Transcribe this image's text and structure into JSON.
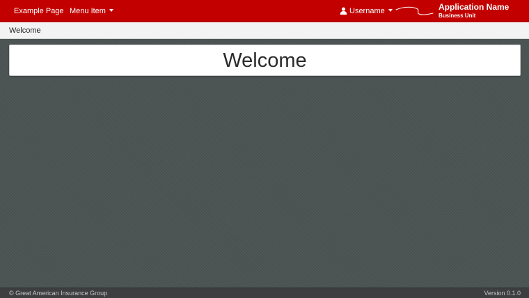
{
  "navbar": {
    "left_items": [
      {
        "label": "Example Page",
        "has_dropdown": false
      },
      {
        "label": "Menu Item",
        "has_dropdown": true
      }
    ],
    "user": {
      "label": "Username",
      "icon": "user-icon",
      "has_dropdown": true
    },
    "brand": {
      "app_name": "Application Name",
      "business_unit": "Business Unit"
    }
  },
  "subheader": {
    "title": "Welcome"
  },
  "main": {
    "heading": "Welcome"
  },
  "footer": {
    "copyright": "© Great American Insurance Group",
    "version": "Version 0.1.0"
  },
  "colors": {
    "navbar_bg": "#c20000",
    "subheader_bg": "#f3f3f3",
    "page_bg": "#4c5453",
    "footer_bg": "#3c3e3f"
  }
}
